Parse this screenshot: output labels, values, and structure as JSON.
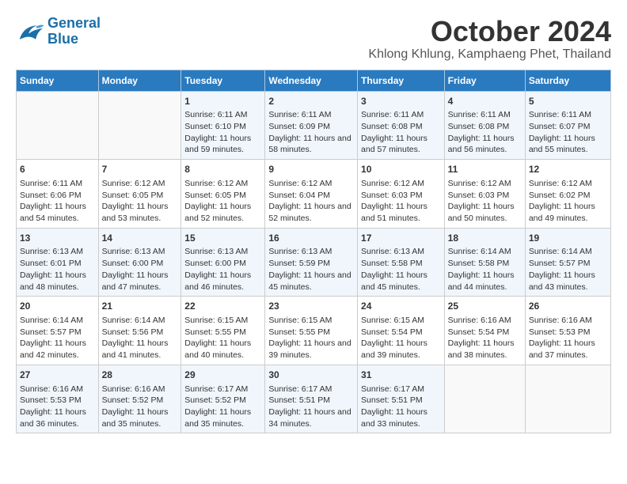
{
  "logo": {
    "line1": "General",
    "line2": "Blue"
  },
  "title": "October 2024",
  "location": "Khlong Khlung, Kamphaeng Phet, Thailand",
  "days_of_week": [
    "Sunday",
    "Monday",
    "Tuesday",
    "Wednesday",
    "Thursday",
    "Friday",
    "Saturday"
  ],
  "weeks": [
    [
      {
        "day": "",
        "content": ""
      },
      {
        "day": "",
        "content": ""
      },
      {
        "day": "1",
        "content": "Sunrise: 6:11 AM\nSunset: 6:10 PM\nDaylight: 11 hours and 59 minutes."
      },
      {
        "day": "2",
        "content": "Sunrise: 6:11 AM\nSunset: 6:09 PM\nDaylight: 11 hours and 58 minutes."
      },
      {
        "day": "3",
        "content": "Sunrise: 6:11 AM\nSunset: 6:08 PM\nDaylight: 11 hours and 57 minutes."
      },
      {
        "day": "4",
        "content": "Sunrise: 6:11 AM\nSunset: 6:08 PM\nDaylight: 11 hours and 56 minutes."
      },
      {
        "day": "5",
        "content": "Sunrise: 6:11 AM\nSunset: 6:07 PM\nDaylight: 11 hours and 55 minutes."
      }
    ],
    [
      {
        "day": "6",
        "content": "Sunrise: 6:11 AM\nSunset: 6:06 PM\nDaylight: 11 hours and 54 minutes."
      },
      {
        "day": "7",
        "content": "Sunrise: 6:12 AM\nSunset: 6:05 PM\nDaylight: 11 hours and 53 minutes."
      },
      {
        "day": "8",
        "content": "Sunrise: 6:12 AM\nSunset: 6:05 PM\nDaylight: 11 hours and 52 minutes."
      },
      {
        "day": "9",
        "content": "Sunrise: 6:12 AM\nSunset: 6:04 PM\nDaylight: 11 hours and 52 minutes."
      },
      {
        "day": "10",
        "content": "Sunrise: 6:12 AM\nSunset: 6:03 PM\nDaylight: 11 hours and 51 minutes."
      },
      {
        "day": "11",
        "content": "Sunrise: 6:12 AM\nSunset: 6:03 PM\nDaylight: 11 hours and 50 minutes."
      },
      {
        "day": "12",
        "content": "Sunrise: 6:12 AM\nSunset: 6:02 PM\nDaylight: 11 hours and 49 minutes."
      }
    ],
    [
      {
        "day": "13",
        "content": "Sunrise: 6:13 AM\nSunset: 6:01 PM\nDaylight: 11 hours and 48 minutes."
      },
      {
        "day": "14",
        "content": "Sunrise: 6:13 AM\nSunset: 6:00 PM\nDaylight: 11 hours and 47 minutes."
      },
      {
        "day": "15",
        "content": "Sunrise: 6:13 AM\nSunset: 6:00 PM\nDaylight: 11 hours and 46 minutes."
      },
      {
        "day": "16",
        "content": "Sunrise: 6:13 AM\nSunset: 5:59 PM\nDaylight: 11 hours and 45 minutes."
      },
      {
        "day": "17",
        "content": "Sunrise: 6:13 AM\nSunset: 5:58 PM\nDaylight: 11 hours and 45 minutes."
      },
      {
        "day": "18",
        "content": "Sunrise: 6:14 AM\nSunset: 5:58 PM\nDaylight: 11 hours and 44 minutes."
      },
      {
        "day": "19",
        "content": "Sunrise: 6:14 AM\nSunset: 5:57 PM\nDaylight: 11 hours and 43 minutes."
      }
    ],
    [
      {
        "day": "20",
        "content": "Sunrise: 6:14 AM\nSunset: 5:57 PM\nDaylight: 11 hours and 42 minutes."
      },
      {
        "day": "21",
        "content": "Sunrise: 6:14 AM\nSunset: 5:56 PM\nDaylight: 11 hours and 41 minutes."
      },
      {
        "day": "22",
        "content": "Sunrise: 6:15 AM\nSunset: 5:55 PM\nDaylight: 11 hours and 40 minutes."
      },
      {
        "day": "23",
        "content": "Sunrise: 6:15 AM\nSunset: 5:55 PM\nDaylight: 11 hours and 39 minutes."
      },
      {
        "day": "24",
        "content": "Sunrise: 6:15 AM\nSunset: 5:54 PM\nDaylight: 11 hours and 39 minutes."
      },
      {
        "day": "25",
        "content": "Sunrise: 6:16 AM\nSunset: 5:54 PM\nDaylight: 11 hours and 38 minutes."
      },
      {
        "day": "26",
        "content": "Sunrise: 6:16 AM\nSunset: 5:53 PM\nDaylight: 11 hours and 37 minutes."
      }
    ],
    [
      {
        "day": "27",
        "content": "Sunrise: 6:16 AM\nSunset: 5:53 PM\nDaylight: 11 hours and 36 minutes."
      },
      {
        "day": "28",
        "content": "Sunrise: 6:16 AM\nSunset: 5:52 PM\nDaylight: 11 hours and 35 minutes."
      },
      {
        "day": "29",
        "content": "Sunrise: 6:17 AM\nSunset: 5:52 PM\nDaylight: 11 hours and 35 minutes."
      },
      {
        "day": "30",
        "content": "Sunrise: 6:17 AM\nSunset: 5:51 PM\nDaylight: 11 hours and 34 minutes."
      },
      {
        "day": "31",
        "content": "Sunrise: 6:17 AM\nSunset: 5:51 PM\nDaylight: 11 hours and 33 minutes."
      },
      {
        "day": "",
        "content": ""
      },
      {
        "day": "",
        "content": ""
      }
    ]
  ]
}
